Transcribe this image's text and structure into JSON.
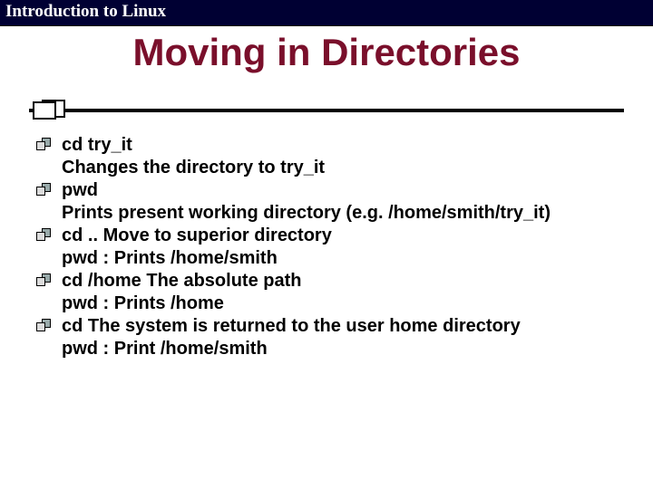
{
  "header": {
    "course_title": "Introduction to Linux"
  },
  "slide": {
    "title": "Moving in Directories"
  },
  "bullets": [
    {
      "line1": "cd try_it",
      "line2": "Changes the directory to try_it"
    },
    {
      "line1": "pwd",
      "line2": "Prints present working directory (e.g. /home/smith/try_it)"
    },
    {
      "line1": "cd .. Move to superior directory",
      "line2": "pwd : Prints /home/smith"
    },
    {
      "line1": "cd /home The absolute path",
      "line2": "pwd : Prints /home"
    },
    {
      "line1": "cd The system is returned to the user home directory",
      "line2": "pwd : Print /home/smith"
    }
  ]
}
